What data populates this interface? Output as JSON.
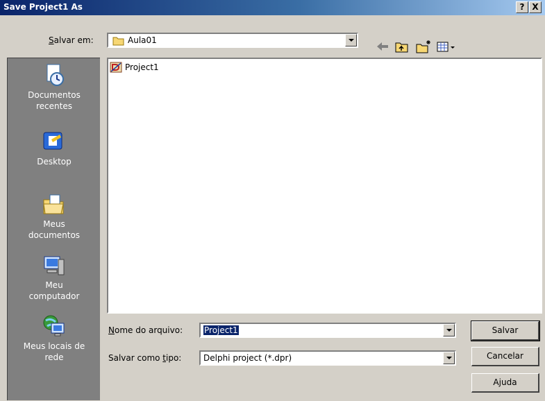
{
  "window": {
    "title": "Save Project1 As",
    "help_label": "?",
    "close_label": "X"
  },
  "location": {
    "label_prefix": "",
    "label_underline": "S",
    "label_rest": "alvar em:",
    "current_folder": "Aula01"
  },
  "toolbar": {
    "icons": [
      "back-icon",
      "up-folder-icon",
      "new-folder-icon",
      "view-menu-icon"
    ]
  },
  "places": [
    {
      "id": "recent",
      "line1": "Documentos",
      "line2": "recentes",
      "icon": "recent-documents-icon"
    },
    {
      "id": "desktop",
      "line1": "Desktop",
      "line2": "",
      "icon": "desktop-icon"
    },
    {
      "id": "mydocs",
      "line1": "Meus",
      "line2": "documentos",
      "icon": "my-documents-icon"
    },
    {
      "id": "mycomputer",
      "line1": "Meu",
      "line2": "computador",
      "icon": "my-computer-icon"
    },
    {
      "id": "network",
      "line1": "Meus locais de",
      "line2": "rede",
      "icon": "network-places-icon"
    }
  ],
  "files": [
    {
      "name": "Project1",
      "icon": "delphi-project-icon"
    }
  ],
  "filename": {
    "label_underline": "N",
    "label_rest": "ome do arquivo:",
    "value": "Project1"
  },
  "filetype": {
    "label_before": "Salvar como ",
    "label_underline": "t",
    "label_rest": "ipo:",
    "value": "Delphi project (*.dpr)"
  },
  "buttons": {
    "save": "Salvar",
    "cancel": "Cancelar",
    "help_before": "A",
    "help_underline": "j",
    "help_after": "uda"
  }
}
